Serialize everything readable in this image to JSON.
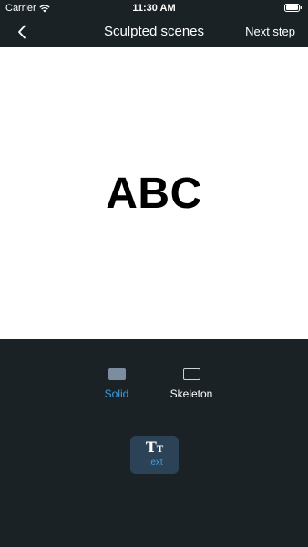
{
  "status_bar": {
    "carrier": "Carrier",
    "time": "11:30 AM"
  },
  "nav": {
    "title": "Sculpted scenes",
    "next_label": "Next step"
  },
  "canvas": {
    "preview_text": "ABC"
  },
  "modes": {
    "selected": "Solid",
    "solid_label": "Solid",
    "skeleton_label": "Skeleton"
  },
  "tools": {
    "text_label": "Text",
    "text_icon_big": "T",
    "text_icon_small": "T"
  },
  "colors": {
    "background": "#1b2226",
    "accent": "#3c9fe6",
    "tile": "#2c4256"
  },
  "icons": [
    "wifi-icon",
    "battery-icon",
    "back-chevron-icon",
    "solid-icon",
    "skeleton-icon",
    "text-tool-icon"
  ]
}
